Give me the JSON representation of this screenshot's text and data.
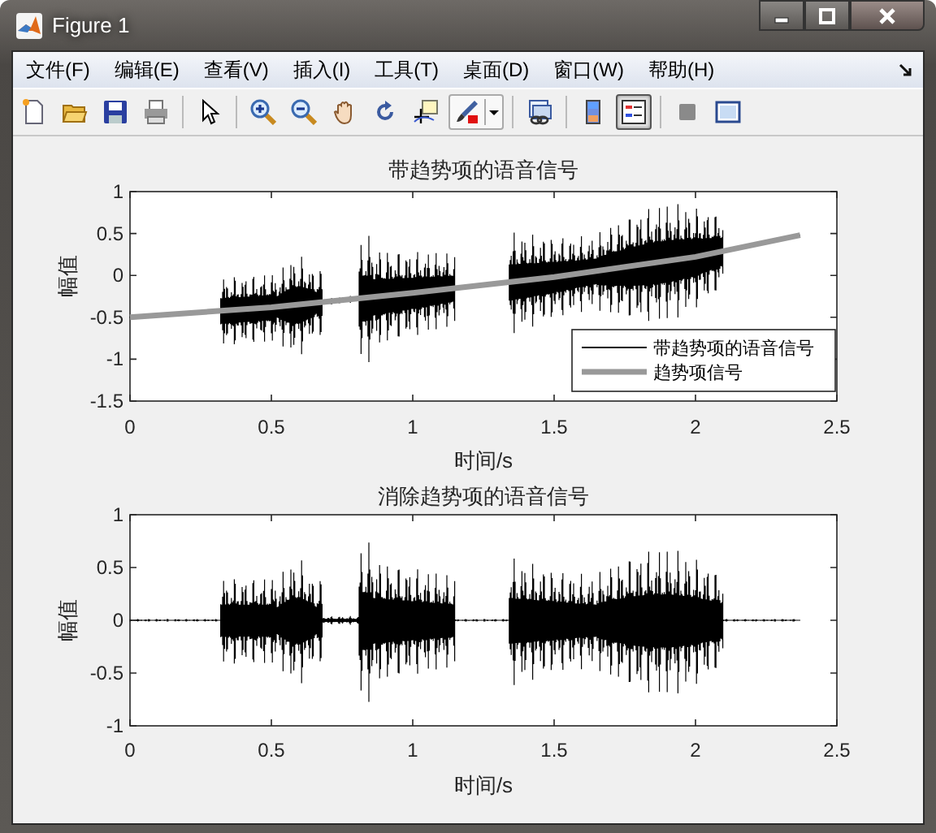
{
  "window": {
    "title": "Figure 1"
  },
  "menu": [
    {
      "label": "文件(F)"
    },
    {
      "label": "编辑(E)"
    },
    {
      "label": "查看(V)"
    },
    {
      "label": "插入(I)"
    },
    {
      "label": "工具(T)"
    },
    {
      "label": "桌面(D)"
    },
    {
      "label": "窗口(W)"
    },
    {
      "label": "帮助(H)"
    }
  ],
  "toolbar": [
    {
      "kind": "new",
      "selected": false
    },
    {
      "kind": "open",
      "selected": false
    },
    {
      "kind": "save",
      "selected": false
    },
    {
      "kind": "print",
      "selected": false
    },
    {
      "kind": "sep"
    },
    {
      "kind": "pointer",
      "selected": false
    },
    {
      "kind": "sep"
    },
    {
      "kind": "zoomin",
      "selected": false
    },
    {
      "kind": "zoomout",
      "selected": false
    },
    {
      "kind": "pan",
      "selected": false
    },
    {
      "kind": "rotate",
      "selected": false
    },
    {
      "kind": "cursor",
      "selected": false
    },
    {
      "kind": "brush",
      "selected": false
    },
    {
      "kind": "sep"
    },
    {
      "kind": "link",
      "selected": false
    },
    {
      "kind": "sep"
    },
    {
      "kind": "colorbar",
      "selected": false
    },
    {
      "kind": "legend",
      "selected": true
    },
    {
      "kind": "sep"
    },
    {
      "kind": "hide",
      "selected": false
    },
    {
      "kind": "show",
      "selected": false
    }
  ],
  "axes": [
    {
      "chart_data": {
        "type": "line",
        "title": "带趋势项的语音信号",
        "xlabel": "时间/s",
        "ylabel": "幅值",
        "x": [
          0,
          0.5,
          1,
          1.5,
          2,
          2.37
        ],
        "series": [
          {
            "name": "趋势项信号",
            "color": "#999999",
            "values": [
              -0.5,
              -0.38,
              -0.21,
              -0.02,
              0.22,
              0.48
            ]
          }
        ],
        "xlim": [
          0,
          2.5
        ],
        "ylim": [
          -1.5,
          1
        ],
        "xticks": [
          0,
          0.5,
          1,
          1.5,
          2,
          2.5
        ],
        "yticks": [
          -1.5,
          -1,
          -0.5,
          0,
          0.5,
          1
        ]
      },
      "legend": [
        {
          "label": "带趋势项的语音信号",
          "kind": "waveform"
        }
      ]
    },
    {
      "chart_data": {
        "type": "line",
        "title": "消除趋势项的语音信号",
        "xlabel": "时间/s",
        "ylabel": "幅值",
        "xlim": [
          0,
          2.5
        ],
        "ylim": [
          -1,
          1
        ],
        "xticks": [
          0,
          0.5,
          1,
          1.5,
          2,
          2.5
        ],
        "yticks": [
          -1,
          -0.5,
          0,
          0.5,
          1
        ]
      }
    }
  ]
}
